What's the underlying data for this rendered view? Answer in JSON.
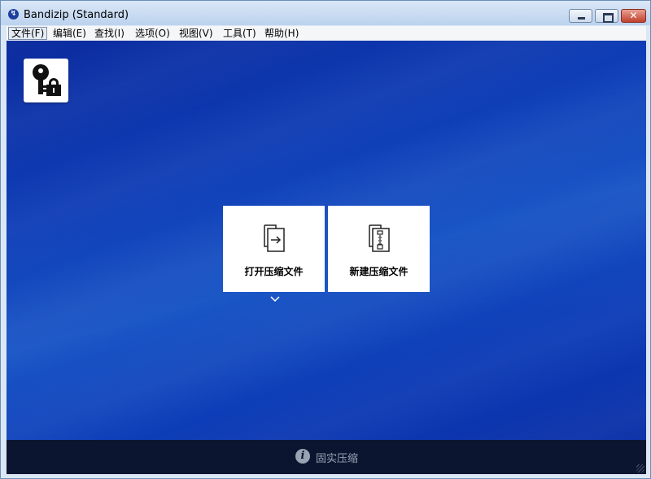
{
  "window": {
    "title": "Bandizip (Standard)"
  },
  "title_controls": {
    "close_glyph": "✕"
  },
  "menu": {
    "items": [
      {
        "label": "文件(F)"
      },
      {
        "label": "编辑(E)"
      },
      {
        "label": "查找(I)"
      },
      {
        "label": "选项(O)"
      },
      {
        "label": "视图(V)"
      },
      {
        "label": "工具(T)"
      },
      {
        "label": "帮助(H)"
      }
    ]
  },
  "main": {
    "open_archive_label": "打开压缩文件",
    "new_archive_label": "新建压缩文件"
  },
  "statusbar": {
    "text": "固实压缩",
    "info_glyph": "i"
  },
  "colors": {
    "accent": "#0f3fb8",
    "statusbar_bg": "#0b1530"
  }
}
